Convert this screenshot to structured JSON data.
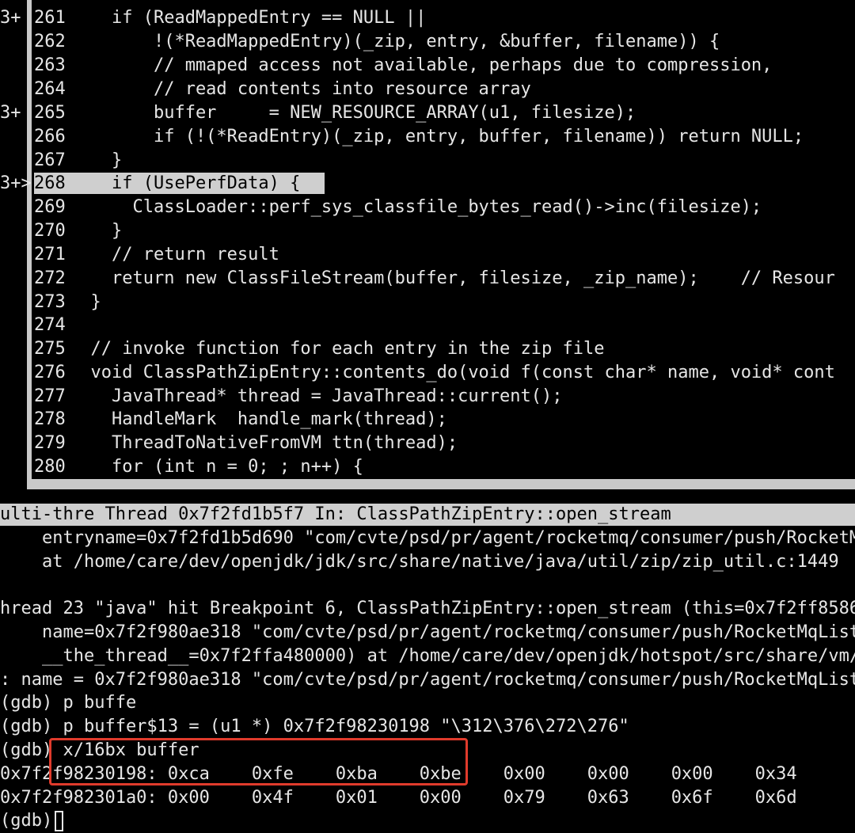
{
  "source": {
    "gutter": [
      "3+",
      "",
      "",
      "",
      "3+",
      "",
      "",
      "3+>",
      "",
      "",
      "",
      "",
      "",
      "",
      "",
      "",
      "",
      "",
      "",
      ""
    ],
    "lines": [
      {
        "num": "261",
        "code": "    if (ReadMappedEntry == NULL ||"
      },
      {
        "num": "262",
        "code": "        !(*ReadMappedEntry)(_zip, entry, &buffer, filename)) {"
      },
      {
        "num": "263",
        "code": "        // mmaped access not available, perhaps due to compression,"
      },
      {
        "num": "264",
        "code": "        // read contents into resource array"
      },
      {
        "num": "265",
        "code": "        buffer     = NEW_RESOURCE_ARRAY(u1, filesize);"
      },
      {
        "num": "266",
        "code": "        if (!(*ReadEntry)(_zip, entry, buffer, filename)) return NULL;"
      },
      {
        "num": "267",
        "code": "    }"
      },
      {
        "num": "268",
        "code": "    if (UsePerfData) {"
      },
      {
        "num": "269",
        "code": "      ClassLoader::perf_sys_classfile_bytes_read()->inc(filesize);"
      },
      {
        "num": "270",
        "code": "    }"
      },
      {
        "num": "271",
        "code": "    // return result"
      },
      {
        "num": "272",
        "code": "    return new ClassFileStream(buffer, filesize, _zip_name);    // Resour"
      },
      {
        "num": "273",
        "code": "  }"
      },
      {
        "num": "274",
        "code": ""
      },
      {
        "num": "275",
        "code": "  // invoke function for each entry in the zip file"
      },
      {
        "num": "276",
        "code": "  void ClassPathZipEntry::contents_do(void f(const char* name, void* cont"
      },
      {
        "num": "277",
        "code": "    JavaThread* thread = JavaThread::current();"
      },
      {
        "num": "278",
        "code": "    HandleMark  handle_mark(thread);"
      },
      {
        "num": "279",
        "code": "    ThreadToNativeFromVM ttn(thread);"
      },
      {
        "num": "280",
        "code": "    for (int n = 0; ; n++) {"
      }
    ]
  },
  "status_bar": "ulti-thre Thread 0x7f2fd1b5f7 In: ClassPathZipEntry::open_stream",
  "console": [
    "    entryname=0x7f2fd1b5d690 \"com/cvte/psd/pr/agent/rocketmq/consumer/push/RocketMq",
    "    at /home/care/dev/openjdk/jdk/src/share/native/java/util/zip/zip_util.c:1449",
    "",
    "hread 23 \"java\" hit Breakpoint 6, ClassPathZipEntry::open_stream (this=0x7f2ff8586",
    "    name=0x7f2f980ae318 \"com/cvte/psd/pr/agent/rocketmq/consumer/push/RocketMqListe",
    "    __the_thread__=0x7f2ffa480000) at /home/care/dev/openjdk/hotspot/src/share/vm/c",
    ": name = 0x7f2f980ae318 \"com/cvte/psd/pr/agent/rocketmq/consumer/push/RocketMqList",
    "(gdb) p buffe",
    "(gdb) p buffer$13 = (u1 *) 0x7f2f98230198 \"\\312\\376\\272\\276\"",
    "(gdb) x/16bx buffer",
    "0x7f2f98230198: 0xca    0xfe    0xba    0xbe    0x00    0x00    0x00    0x34",
    "0x7f2f982301a0: 0x00    0x4f    0x01    0x00    0x79    0x63    0x6f    0x6d",
    "(gdb) "
  ]
}
